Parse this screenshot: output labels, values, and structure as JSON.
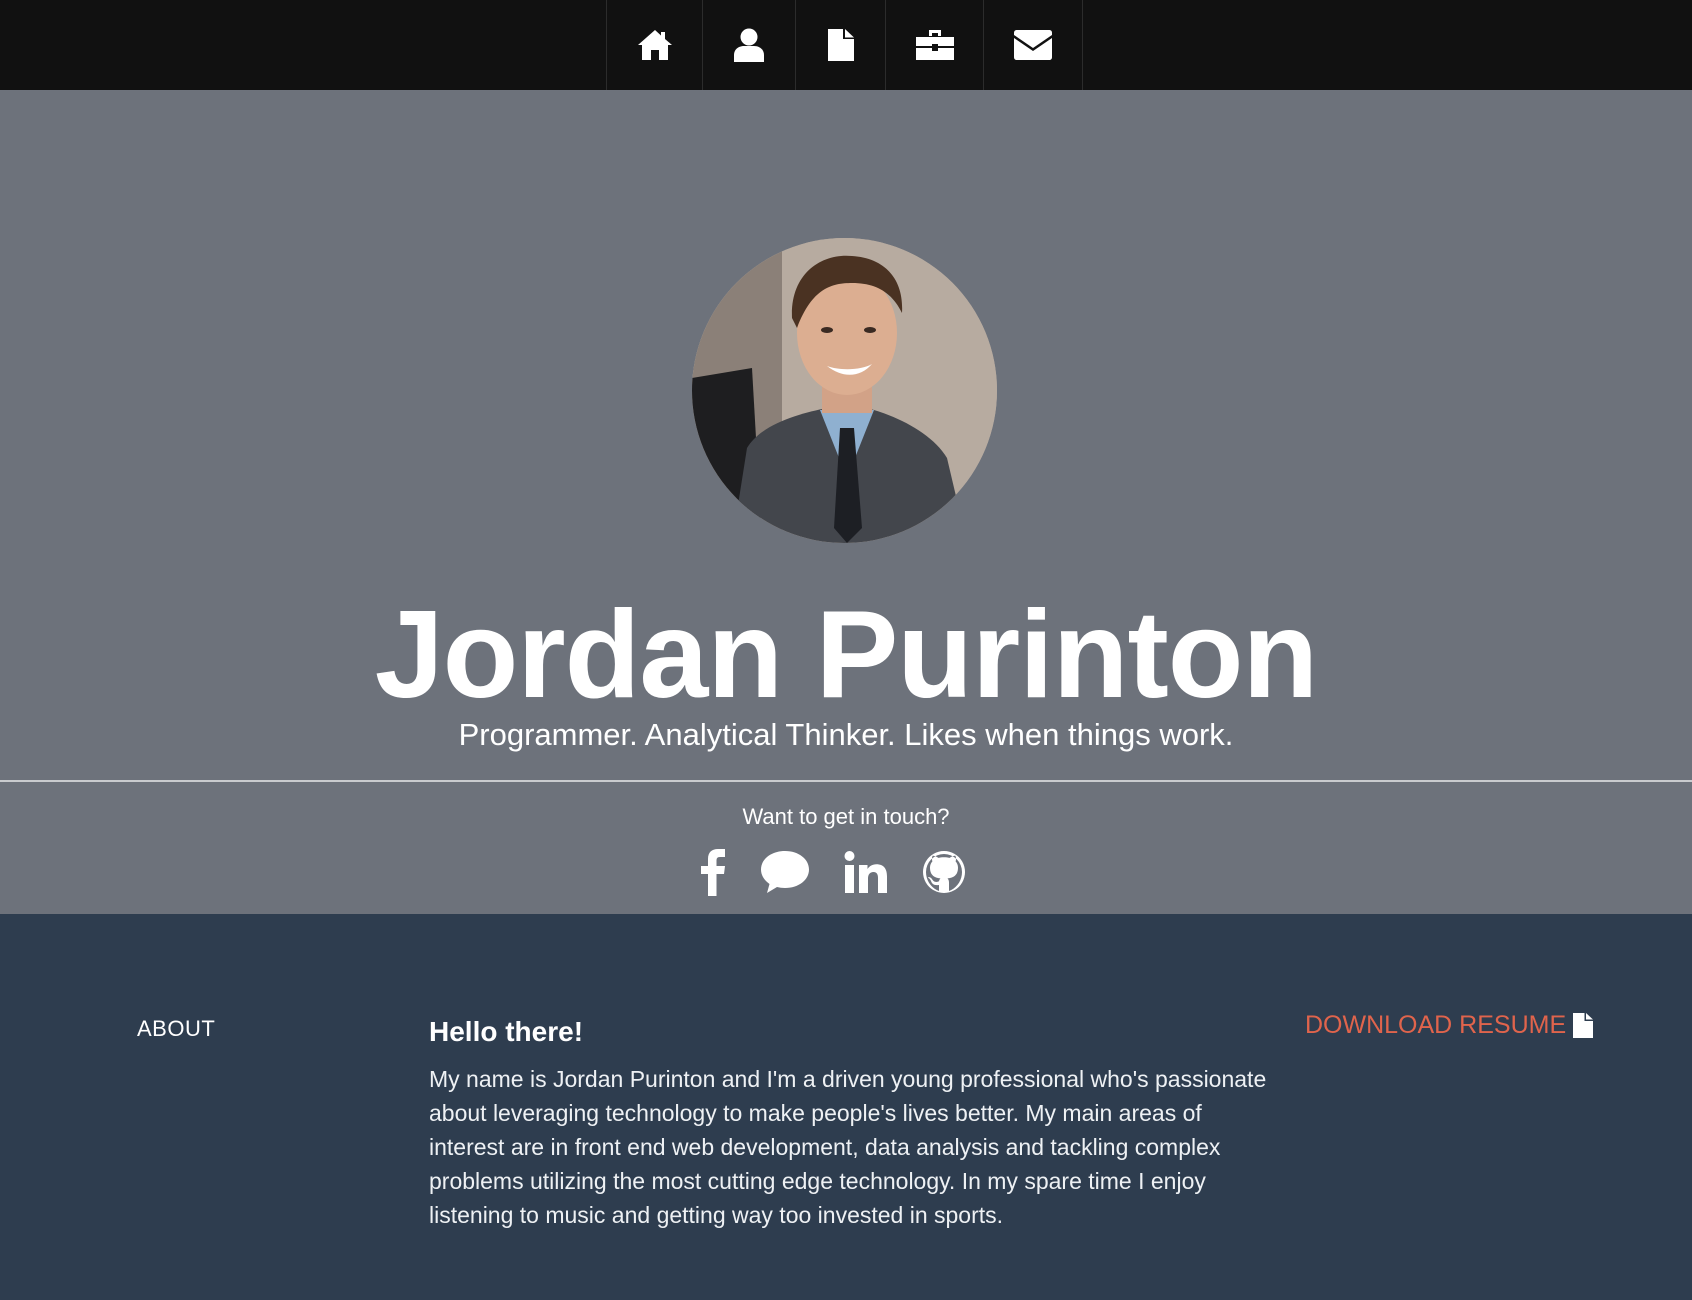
{
  "nav": {
    "items": [
      {
        "icon": "home-icon"
      },
      {
        "icon": "user-icon"
      },
      {
        "icon": "file-icon"
      },
      {
        "icon": "briefcase-icon"
      },
      {
        "icon": "envelope-icon"
      }
    ]
  },
  "hero": {
    "name": "Jordan Purinton",
    "tagline": "Programmer. Analytical Thinker. Likes when things work."
  },
  "contact": {
    "prompt": "Want to get in touch?",
    "socials": [
      "facebook-icon",
      "chat-bubble-icon",
      "linkedin-icon",
      "github-icon"
    ]
  },
  "about": {
    "heading": "ABOUT",
    "title": "Hello there!",
    "text": "My name is Jordan Purinton and I'm a driven young professional who's passionate about leveraging technology to make people's lives better. My main areas of interest are in front end web development, data analysis and tackling complex problems utilizing the most cutting edge technology. In my spare time I enjoy listening to music and getting way too invested in sports.",
    "download_label": "DOWNLOAD RESUME"
  },
  "colors": {
    "nav_bg": "#111111",
    "hero_bg": "#6d727b",
    "about_bg": "#2e3d4f",
    "accent": "#e0644c"
  }
}
